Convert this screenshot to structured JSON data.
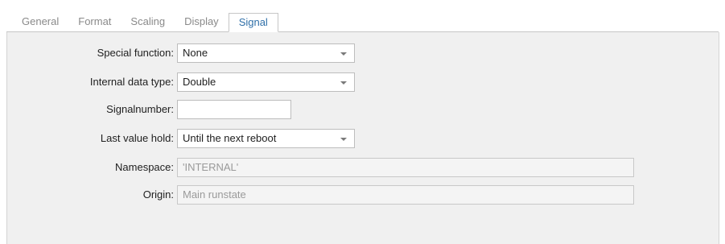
{
  "tabs": [
    {
      "label": "General",
      "active": false
    },
    {
      "label": "Format",
      "active": false
    },
    {
      "label": "Scaling",
      "active": false
    },
    {
      "label": "Display",
      "active": false
    },
    {
      "label": "Signal",
      "active": true
    }
  ],
  "form": {
    "special_function": {
      "label": "Special function:",
      "value": "None"
    },
    "internal_data_type": {
      "label": "Internal data type:",
      "value": "Double"
    },
    "signalnumber": {
      "label": "Signalnumber:",
      "value": ""
    },
    "last_value_hold": {
      "label": "Last value hold:",
      "value": "Until the next reboot"
    },
    "namespace": {
      "label": "Namespace:",
      "value": "'INTERNAL'"
    },
    "origin": {
      "label": "Origin:",
      "value": "Main runstate"
    }
  },
  "icons": {
    "dropdown": "chevron-down-icon"
  },
  "colors": {
    "active_tab_text": "#2f6fa8",
    "panel_background": "#f0f0f0",
    "disabled_text": "#9a9a9a"
  }
}
